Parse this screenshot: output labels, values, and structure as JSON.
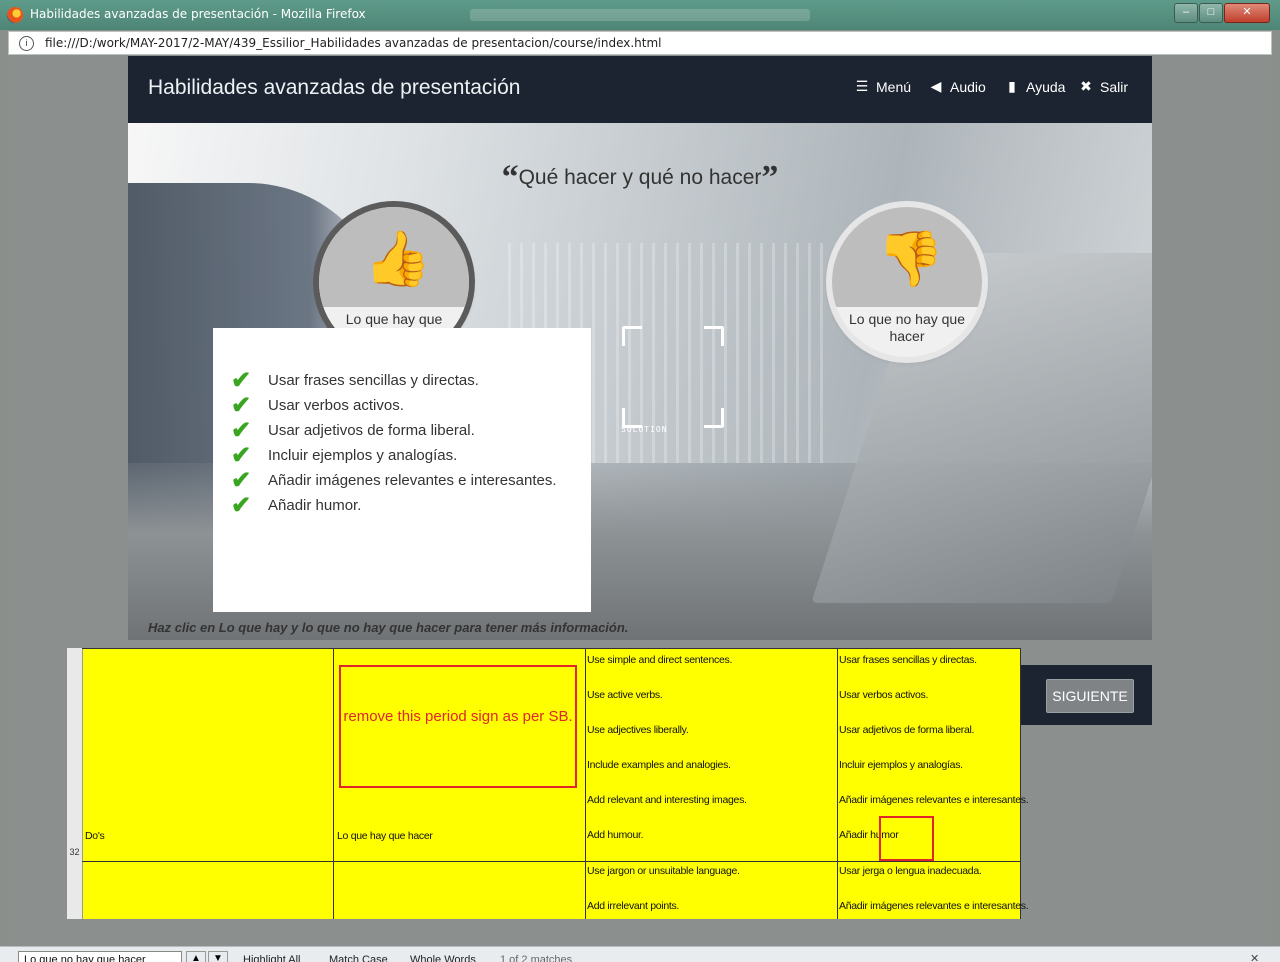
{
  "window": {
    "title": "Habilidades avanzadas de presentación - Mozilla Firefox",
    "url": "file:///D:/work/MAY-2017/2-MAY/439_Essilior_Habilidades avanzadas de presentacion/course/index.html",
    "controls": {
      "minimize": "–",
      "maximize": "□",
      "close": "✕"
    }
  },
  "course": {
    "title": "Habilidades avanzadas de presentación",
    "nav": [
      {
        "label": "Menú",
        "icon": "list-icon"
      },
      {
        "label": "Audio",
        "icon": "speaker-icon"
      },
      {
        "label": "Ayuda",
        "icon": "book-icon"
      },
      {
        "label": "Salir",
        "icon": "close-icon"
      }
    ],
    "heading": "Qué hacer y qué no hacer",
    "do_button": {
      "label": "Lo que hay que hacer",
      "icon": "thumbs-up-icon"
    },
    "dont_button": {
      "label": "Lo que no hay que hacer",
      "icon": "thumbs-down-icon"
    },
    "solution_label": "SOLUTION",
    "do_items": [
      "Usar frases sencillas y directas.",
      "Usar verbos activos.",
      "Usar adjetivos de forma liberal.",
      "Incluir ejemplos y analogías.",
      "Añadir imágenes relevantes e interesantes.",
      "Añadir humor."
    ],
    "instruction": "Haz clic en Lo que hay y lo que no hay que hacer para tener más información.",
    "next_label": "SIGUIENTE"
  },
  "sheet": {
    "row_number": "32",
    "col_a": "Do's",
    "col_b": "Lo que hay que hacer",
    "comment": "remove this period sign as per SB.",
    "english": [
      "Use simple and direct sentences.",
      "Use active verbs.",
      "Use adjectives liberally.",
      "Include examples and analogies.",
      "Add relevant and interesting images.",
      "Add humour."
    ],
    "spanish": [
      "Usar frases sencillas y directas.",
      "Usar verbos activos.",
      "Usar adjetivos de forma liberal.",
      "Incluir ejemplos y analogías.",
      "Añadir imágenes relevantes e interesantes.",
      "Añadir humor"
    ],
    "next_english": [
      "Use jargon or unsuitable language.",
      "Add irrelevant points."
    ],
    "next_spanish": [
      "Usar jerga o lengua inadecuada.",
      "Añadir imágenes relevantes e interesantes."
    ]
  },
  "findbar": {
    "query": "Lo que no hay que hacer",
    "highlight_all": "Highlight All",
    "match_case": "Match Case",
    "whole_words": "Whole Words",
    "matches": "1 of 2 matches"
  },
  "colors": {
    "header_bg": "#1b2430",
    "sheet_bg": "#ffff00",
    "annotation_red": "#e0262b",
    "check_green": "#3aa520"
  }
}
